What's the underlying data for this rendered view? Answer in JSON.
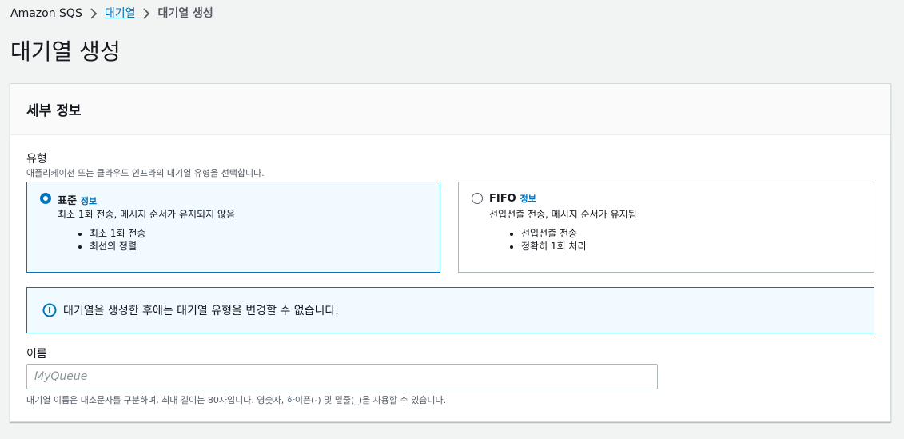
{
  "breadcrumb": {
    "items": [
      "Amazon SQS",
      "대기열"
    ],
    "current": "대기열 생성"
  },
  "page_title": "대기열 생성",
  "panel": {
    "title": "세부 정보",
    "type_field": {
      "label": "유형",
      "description": "애플리케이션 또는 클라우드 인프라의 대기열 유형을 선택합니다.",
      "options": [
        {
          "title": "표준",
          "info": "정보",
          "description": "최소 1회 전송, 메시지 순서가 유지되지 않음",
          "bullets": [
            "최소 1회 전송",
            "최선의 정렬"
          ],
          "selected": true
        },
        {
          "title": "FIFO",
          "info": "정보",
          "description": "선입선출 전송, 메시지 순서가 유지됨",
          "bullets": [
            "선입선출 전송",
            "정확히 1회 처리"
          ],
          "selected": false
        }
      ]
    },
    "alert": {
      "icon": "info-circle-icon",
      "text": "대기열을 생성한 후에는 대기열 유형을 변경할 수 없습니다."
    },
    "name_field": {
      "label": "이름",
      "placeholder": "MyQueue",
      "value": "",
      "constraint": "대기열 이름은 대소문자를 구분하며, 최대 길이는 80자입니다. 영숫자, 하이픈(-) 및 밑줄(_)을 사용할 수 있습니다."
    }
  },
  "colors": {
    "link": "#0073bb",
    "selected_bg": "#f1faff",
    "background": "#f2f3f3"
  }
}
